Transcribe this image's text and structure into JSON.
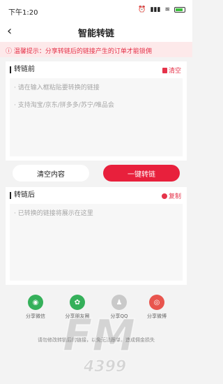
{
  "status_bar": {
    "time": "下午1:20",
    "battery": "56"
  },
  "nav": {
    "title": "智能转链"
  },
  "notice": {
    "text": "ⓘ 温馨提示：分享转链后的链接产生的订单才能锁佣"
  },
  "input_card": {
    "title": "转链前",
    "action_label": "清空",
    "placeholders": [
      "· 请在输入框粘贴要转换的链接",
      "· 支持淘宝/京东/拼多多/苏宁/唯品会"
    ]
  },
  "buttons": {
    "clear": "清空内容",
    "convert": "一键转链"
  },
  "output_card": {
    "title": "转链后",
    "action_label": "复制",
    "placeholder": "· 已转换的链接将展示在这里"
  },
  "share": [
    {
      "label": "分享微信",
      "icon": "wechat-icon",
      "color": "#35b05a"
    },
    {
      "label": "分享朋友圈",
      "icon": "moments-icon",
      "color": "#35b05a"
    },
    {
      "label": "分享QQ",
      "icon": "qq-icon",
      "color": "#c9c9c9"
    },
    {
      "label": "分享微博",
      "icon": "weibo-icon",
      "color": "#e8554e"
    }
  ],
  "bottom_tip": "请勿修改转链后的链接，以免无法跟单，造成佣金损失",
  "watermark": {
    "text": "FM",
    "subtext": "4399"
  },
  "colors": {
    "accent": "#e8203c",
    "notice_bg": "#fde9ea"
  }
}
